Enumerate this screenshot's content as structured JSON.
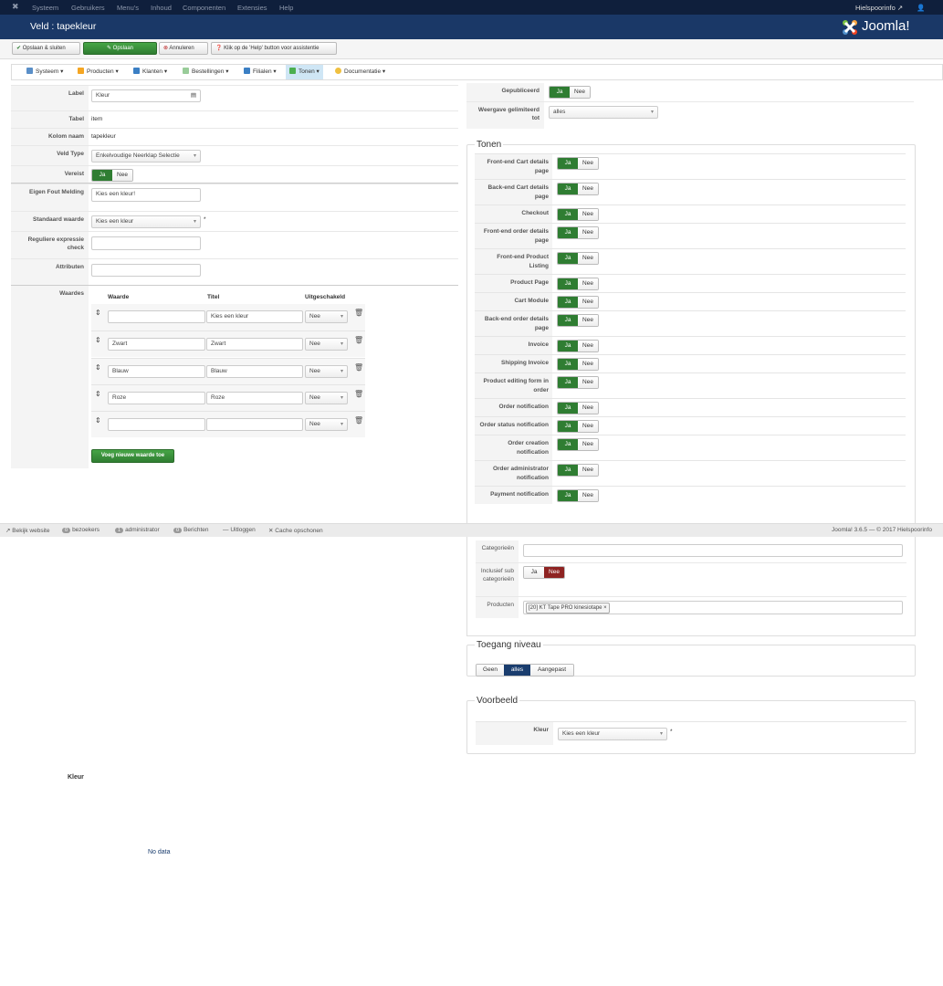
{
  "topnav": {
    "items": [
      "Systeem",
      "Gebruikers",
      "Menu's",
      "Inhoud",
      "Componenten",
      "Extensies",
      "Help"
    ],
    "site_link": "Hielspoorinfo",
    "brand": "Joomla!"
  },
  "title": "Veld : tapekleur",
  "toolbar": {
    "save_close": "Opslaan & sluiten",
    "save": "Opslaan",
    "cancel": "Annuleren",
    "help": "Klik op de 'Help' button voor assistentie"
  },
  "menubar": [
    "Systeem",
    "Producten",
    "Klanten",
    "Bestellingen",
    "Filialen",
    "Tonen",
    "Documentatie"
  ],
  "form": {
    "label_l": "Label",
    "label_v": "Kleur",
    "tabel_l": "Tabel",
    "tabel_v": "item",
    "kolom_l": "Kolom naam",
    "kolom_v": "tapekleur",
    "veldtype_l": "Veld Type",
    "veldtype_v": "Enkelvoudige Neerklap Selectie",
    "vereist_l": "Vereist",
    "fout_l": "Eigen Fout Melding",
    "fout_v": "Kies een kleur!",
    "standaard_l": "Standaard waarde",
    "standaard_v": "Kies een kleur",
    "required_mark": "*",
    "regex_l": "Reguliere expressie check",
    "attr_l": "Attributen",
    "waardes_l": "Waardes",
    "col_waarde": "Waarde",
    "col_titel": "Titel",
    "col_uit": "Uitgeschakeld",
    "rows": [
      {
        "waarde": "",
        "titel": "Kies een kleur",
        "uit": "Nee"
      },
      {
        "waarde": "Zwart",
        "titel": "Zwart",
        "uit": "Nee"
      },
      {
        "waarde": "Blauw",
        "titel": "Blauw",
        "uit": "Nee"
      },
      {
        "waarde": "Roze",
        "titel": "Roze",
        "uit": "Nee"
      },
      {
        "waarde": "",
        "titel": "",
        "uit": "Nee"
      }
    ],
    "add_value": "Voeg nieuwe waarde toe"
  },
  "yes": "Ja",
  "no": "Nee",
  "right": {
    "gepubliceerd_l": "Gepubliceerd",
    "weergave_l": "Weergave gelimiteerd tot",
    "weergave_v": "alles",
    "tonen_legend": "Tonen",
    "tonen": [
      "Front-end Cart details page",
      "Back-end Cart details page",
      "Checkout",
      "Front-end order details page",
      "Front-end Product Listing",
      "Product Page",
      "Cart Module",
      "Back-end order details page",
      "Invoice",
      "Shipping Invoice",
      "Product editing form in order",
      "Order notification",
      "Order status notification",
      "Order creation notification",
      "Order administrator notification",
      "Payment notification"
    ],
    "categorieen_l": "Categorieën",
    "inclusief_l": "Inclusief sub categorieën",
    "producten_l": "Producten",
    "product_tag": "[20] KT Tape PRO kinesiotape",
    "toegang_legend": "Toegang niveau",
    "toegang": [
      "Geen",
      "alles",
      "Aangepast"
    ],
    "voorbeeld_legend": "Voorbeeld",
    "voorbeeld_l": "Kleur",
    "voorbeeld_v": "Kies een kleur"
  },
  "statusbar": {
    "view_site": "Bekijk website",
    "visitors_count": "0",
    "visitors": "bezoekers",
    "admin_count": "1",
    "admin": "administrator",
    "messages_count": "0",
    "messages": "Berichten",
    "logout": "Uitloggen",
    "cache": "Cache opschonen",
    "version": "Joomla! 3.6.5 — © 2017 Hielspoorinfo"
  },
  "below": {
    "kleur": "Kleur",
    "nodata": "No data"
  }
}
